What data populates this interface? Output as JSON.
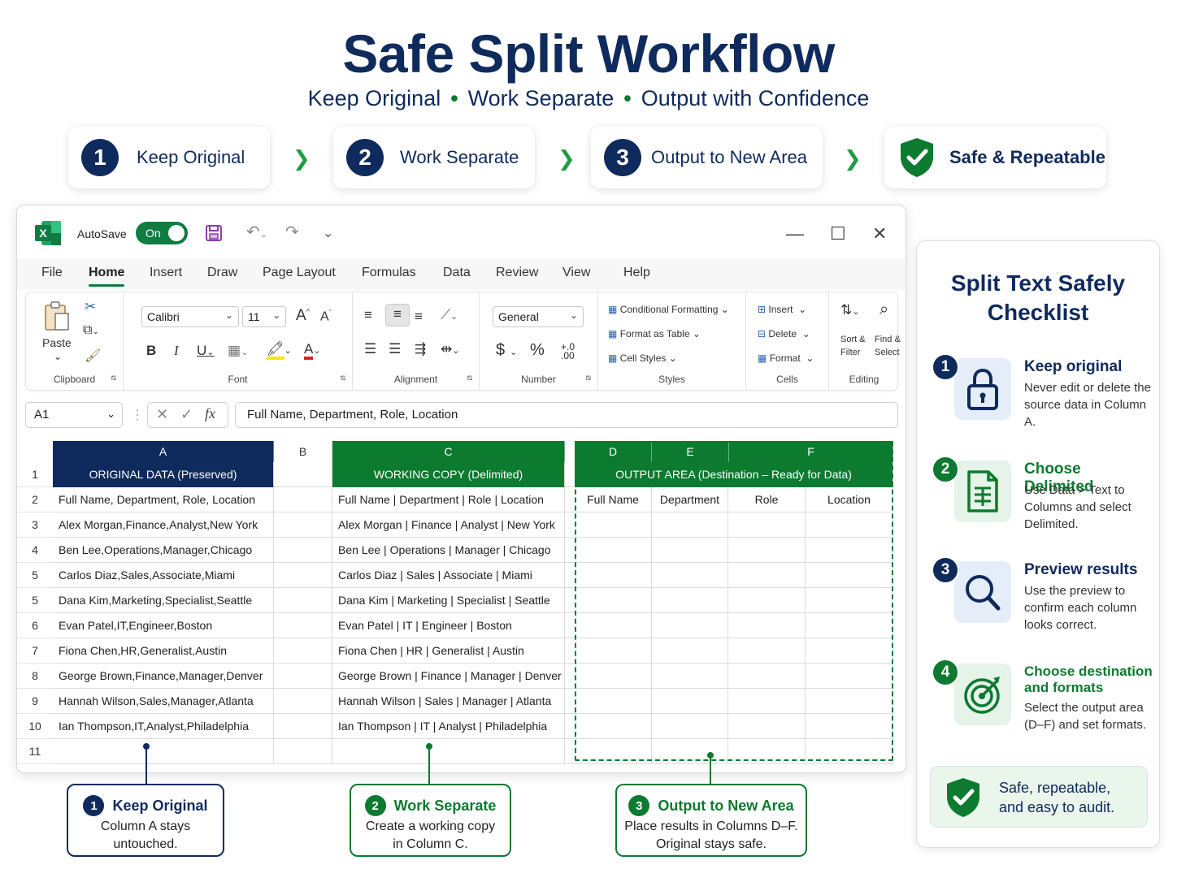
{
  "header": {
    "title": "Safe Split Workflow",
    "subtitle_parts": [
      "Keep Original",
      "Work Separate",
      "Output with Confidence"
    ]
  },
  "steps": [
    {
      "num": "1",
      "label": "Keep Original"
    },
    {
      "num": "2",
      "label": "Work Separate"
    },
    {
      "num": "3",
      "label": "Output to New Area"
    }
  ],
  "safe_badge": {
    "label": "Safe & Repeatable"
  },
  "excel": {
    "autosave_label": "AutoSave",
    "autosave_state": "On",
    "menu": [
      "File",
      "Home",
      "Insert",
      "Draw",
      "Page Layout",
      "Formulas",
      "Data",
      "Review",
      "View",
      "Help"
    ],
    "active_menu": "Home",
    "ribbon": {
      "paste": "Paste",
      "clipboard": "Clipboard",
      "font_name": "Calibri",
      "font_size": "11",
      "font_group": "Font",
      "bold": "B",
      "italic": "I",
      "underline": "U",
      "alignment": "Alignment",
      "number_format": "General",
      "number": "Number",
      "conditional_formatting": "Conditional Formatting",
      "format_as_table": "Format as Table",
      "cell_styles": "Cell Styles",
      "styles": "Styles",
      "insert": "Insert",
      "delete": "Delete",
      "format": "Format",
      "cells": "Cells",
      "sort_filter": "Sort & Filter",
      "find_select": "Find & Select",
      "editing": "Editing"
    },
    "name_box": "A1",
    "formula": "Full Name, Department, Role, Location",
    "columns": [
      "A",
      "B",
      "C",
      "D",
      "E",
      "F"
    ],
    "header_row": {
      "row_num": "1",
      "a": "ORIGINAL DATA (Preserved)",
      "c": "WORKING COPY (Delimited)",
      "def": "OUTPUT AREA (Destination – Ready for Data)"
    },
    "output_headers": [
      "Full Name",
      "Department",
      "Role",
      "Location"
    ],
    "rows": [
      {
        "num": "2",
        "a": "Full Name, Department, Role, Location",
        "c": "Full Name | Department | Role | Location"
      },
      {
        "num": "3",
        "a": "Alex Morgan,Finance,Analyst,New York",
        "c": "Alex Morgan | Finance | Analyst | New York"
      },
      {
        "num": "4",
        "a": "Ben Lee,Operations,Manager,Chicago",
        "c": "Ben Lee | Operations | Manager | Chicago"
      },
      {
        "num": "5",
        "a": "Carlos Diaz,Sales,Associate,Miami",
        "c": "Carlos Diaz | Sales | Associate | Miami"
      },
      {
        "num": "5",
        "a": "Dana Kim,Marketing,Specialist,Seattle",
        "c": "Dana Kim | Marketing | Specialist | Seattle"
      },
      {
        "num": "6",
        "a": "Evan Patel,IT,Engineer,Boston",
        "c": "Evan Patel | IT | Engineer | Boston"
      },
      {
        "num": "7",
        "a": "Fiona Chen,HR,Generalist,Austin",
        "c": "Fiona Chen | HR | Generalist | Austin"
      },
      {
        "num": "8",
        "a": "George Brown,Finance,Manager,Denver",
        "c": "George Brown | Finance | Manager | Denver"
      },
      {
        "num": "9",
        "a": "Hannah Wilson,Sales,Manager,Atlanta",
        "c": "Hannah Wilson | Sales | Manager | Atlanta"
      },
      {
        "num": "10",
        "a": "Ian Thompson,IT,Analyst,Philadelphia",
        "c": "Ian Thompson | IT | Analyst | Philadelphia"
      },
      {
        "num": "11",
        "a": "",
        "c": ""
      }
    ]
  },
  "callouts": [
    {
      "num": "1",
      "title": "Keep Original",
      "line1": "Column A stays",
      "line2": "untouched."
    },
    {
      "num": "2",
      "title": "Work Separate",
      "line1": "Create a working copy",
      "line2": "in Column C."
    },
    {
      "num": "3",
      "title": "Output to New Area",
      "line1": "Place results in Columns D–F.",
      "line2": "Original stays safe."
    }
  ],
  "checklist": {
    "title_line1": "Split Text Safely",
    "title_line2": "Checklist",
    "items": [
      {
        "num": "1",
        "head": "Keep original",
        "body": "Never edit or delete the source data in Column A.",
        "icon": "lock-icon"
      },
      {
        "num": "2",
        "head": "Choose Delimited",
        "body": "Use Data > Text to Columns and select Delimited.",
        "icon": "document-icon"
      },
      {
        "num": "3",
        "head": "Preview results",
        "body": "Use the preview to confirm each column looks correct.",
        "icon": "magnifier-icon"
      },
      {
        "num": "4",
        "head": "Choose destination and formats",
        "body": "Select the output area (D–F) and set formats.",
        "icon": "target-icon"
      }
    ],
    "footer": "Safe, repeatable, and easy to audit."
  },
  "colors": {
    "navy": "#0f2a5c",
    "green": "#0c7a2f",
    "excel_green": "#107c41"
  }
}
